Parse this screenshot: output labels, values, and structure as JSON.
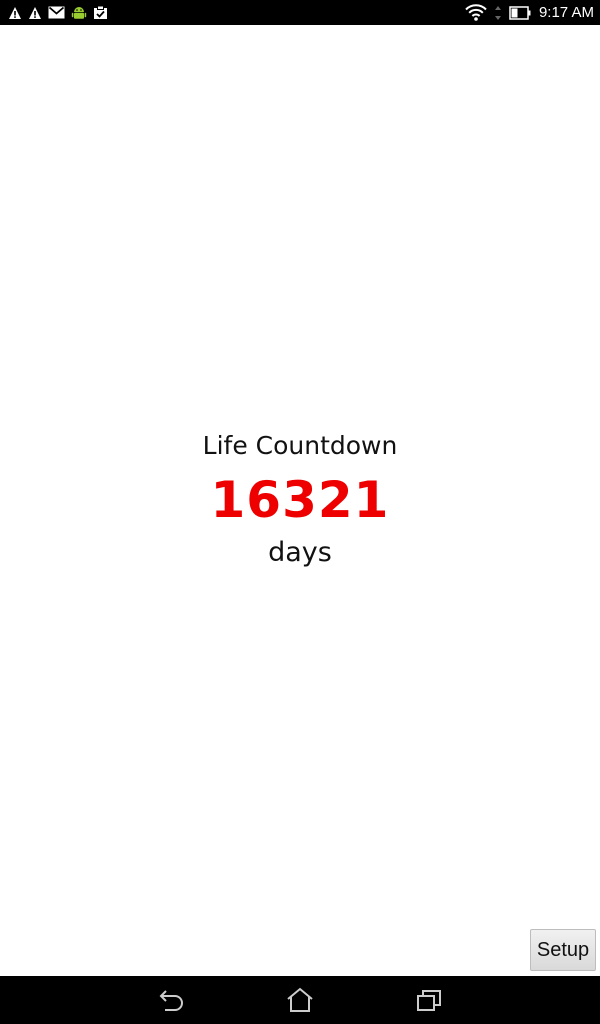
{
  "status_bar": {
    "time": "9:17 AM",
    "left_icons": [
      "warning-icon",
      "warning-icon",
      "gmail-icon",
      "android-debug-icon",
      "clipboard-check-icon"
    ],
    "right_icons": [
      "wifi-icon",
      "data-arrows-icon",
      "battery-icon"
    ]
  },
  "main": {
    "title": "Life Countdown",
    "days_value": "16321",
    "unit_label": "days",
    "value_color": "#ee0000"
  },
  "setup_button": {
    "label": "Setup"
  },
  "nav_bar": {
    "buttons": [
      "back-icon",
      "home-icon",
      "recent-apps-icon"
    ]
  }
}
